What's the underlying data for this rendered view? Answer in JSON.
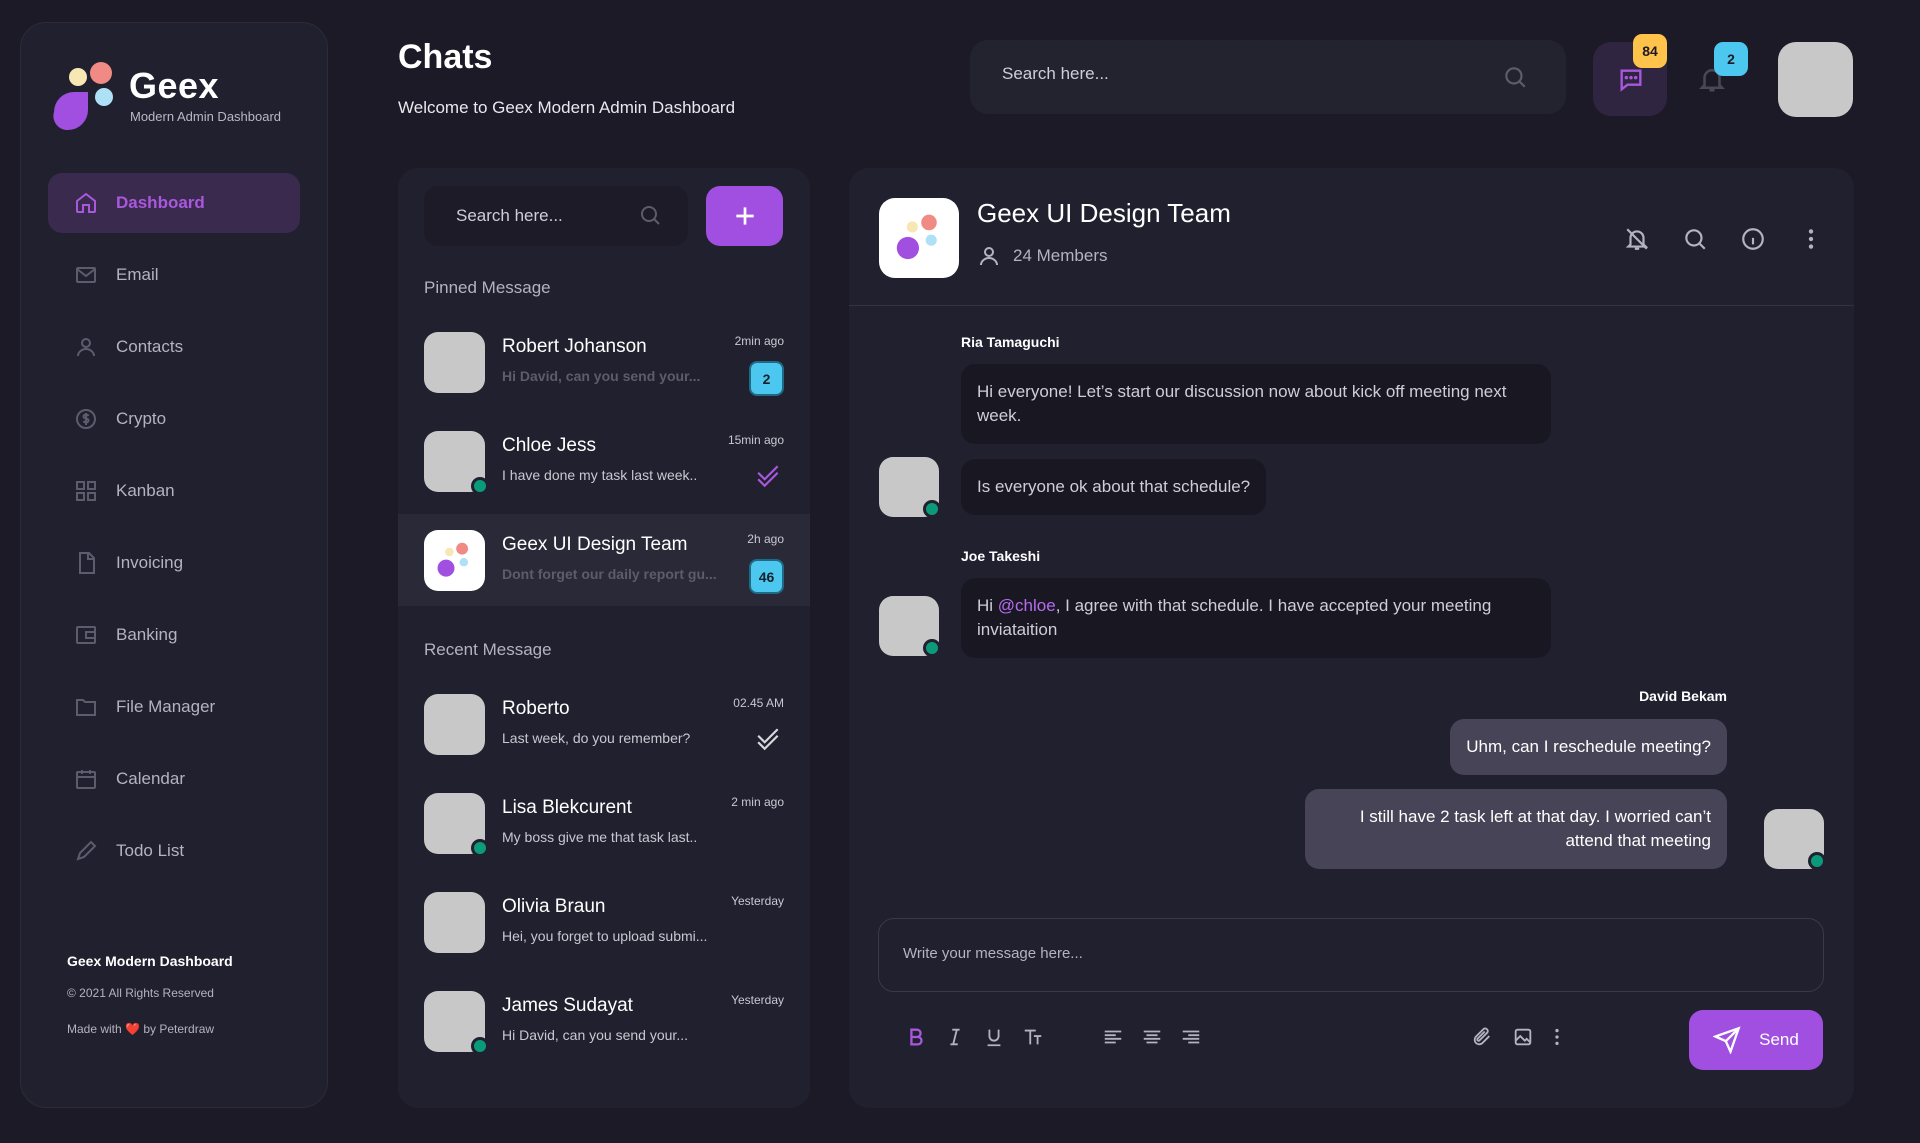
{
  "brand": {
    "name": "Geex",
    "tagline": "Modern Admin Dashboard"
  },
  "sidebar": {
    "items": [
      {
        "label": "Dashboard",
        "icon": "home-icon",
        "active": true
      },
      {
        "label": "Email",
        "icon": "mail-icon"
      },
      {
        "label": "Contacts",
        "icon": "user-icon"
      },
      {
        "label": "Crypto",
        "icon": "dollar-circle-icon"
      },
      {
        "label": "Kanban",
        "icon": "grid-icon"
      },
      {
        "label": "Invoicing",
        "icon": "document-icon"
      },
      {
        "label": "Banking",
        "icon": "wallet-icon"
      },
      {
        "label": "File Manager",
        "icon": "folder-icon"
      },
      {
        "label": "Calendar",
        "icon": "calendar-icon"
      },
      {
        "label": "Todo List",
        "icon": "pencil-icon"
      }
    ],
    "footer": {
      "title": "Geex Modern Dashboard",
      "copyright": "© 2021 All Rights Reserved",
      "made_prefix": "Made with",
      "heart": "❤️",
      "made_suffix": "by Peterdraw"
    }
  },
  "header": {
    "title": "Chats",
    "subtitle": "Welcome to Geex Modern Admin Dashboard",
    "search_placeholder": "Search here...",
    "chat_badge": "84",
    "bell_badge": "2"
  },
  "chat_list": {
    "search_placeholder": "Search here...",
    "pinned_label": "Pinned Message",
    "recent_label": "Recent Message",
    "pinned": [
      {
        "name": "Robert Johanson",
        "preview": "Hi David, can you send your...",
        "time": "2min ago",
        "count": "2",
        "faded": true
      },
      {
        "name": "Chloe Jess",
        "preview": "I have done my task last week..",
        "time": "15min ago",
        "status": "read",
        "online": true
      },
      {
        "name": "Geex UI Design Team",
        "preview": "Dont forget our daily report gu...",
        "time": "2h ago",
        "count": "46",
        "faded": true,
        "active": true
      }
    ],
    "recent": [
      {
        "name": "Roberto",
        "preview": "Last week, do you remember?",
        "time": "02.45 AM",
        "status": "delivered"
      },
      {
        "name": "Lisa Blekcurent",
        "preview": "My boss give me that task last..",
        "time": "2 min ago",
        "online": true
      },
      {
        "name": "Olivia Braun",
        "preview": "Hei, you forget to upload submi...",
        "time": "Yesterday"
      },
      {
        "name": "James Sudayat",
        "preview": "Hi David, can you send your...",
        "time": "Yesterday",
        "online": true
      }
    ]
  },
  "conversation": {
    "group_name": "Geex UI Design Team",
    "members": "24 Members",
    "messages": [
      {
        "sender": "Ria Tamaguchi",
        "text": "Hi everyone! Let’s start our discussion now about kick off meeting next week."
      },
      {
        "text": "Is everyone ok about that schedule?"
      },
      {
        "sender": "Joe Takeshi",
        "text_prefix": "Hi ",
        "mention": "@chloe",
        "text_suffix": ", I agree with that schedule. I have accepted your meeting inviataition"
      },
      {
        "sender": "David Bekam",
        "text": "Uhm, can I reschedule meeting?"
      },
      {
        "text": "I still have 2 task left at that day. I worried can’t attend that meeting"
      }
    ],
    "composer_placeholder": "Write your message here...",
    "send_label": "Send"
  },
  "colors": {
    "accent": "#a04fe0",
    "badge_yellow": "#ffc24b",
    "badge_blue": "#4cc7ef",
    "online": "#0c9b7a"
  }
}
